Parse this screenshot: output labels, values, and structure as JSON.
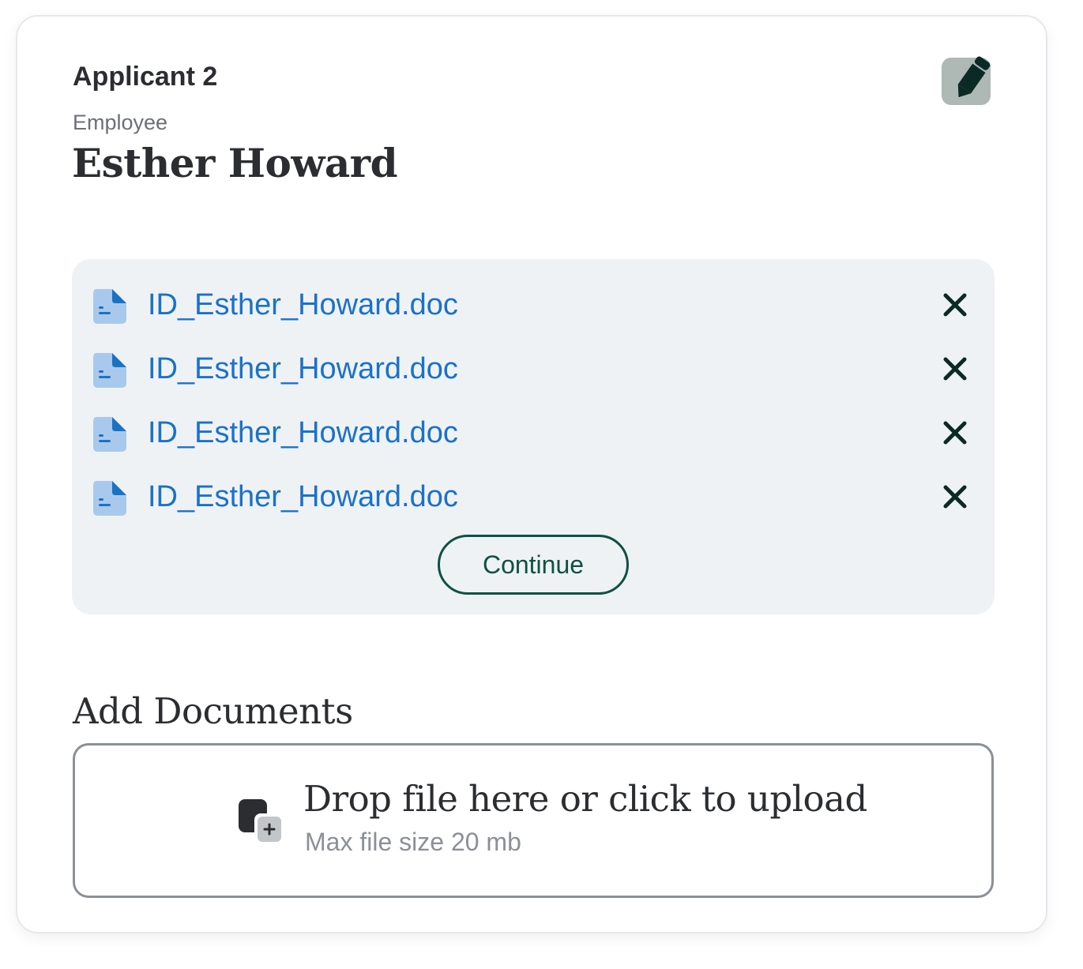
{
  "applicant": {
    "label": "Applicant 2",
    "role": "Employee",
    "name": "Esther Howard",
    "edit_icon": "pencil-icon"
  },
  "files": {
    "items": [
      {
        "name": "ID_Esther_Howard.doc"
      },
      {
        "name": "ID_Esther_Howard.doc"
      },
      {
        "name": "ID_Esther_Howard.doc"
      },
      {
        "name": "ID_Esther_Howard.doc"
      }
    ],
    "file_icon": "document-icon",
    "remove_icon": "close-icon",
    "continue_label": "Continue"
  },
  "upload": {
    "section_title": "Add Documents",
    "drop_text": "Drop file here or click to upload",
    "hint": "Max file size 20 mb",
    "icon": "upload-file-icon"
  },
  "colors": {
    "accent_green": "#0e5145",
    "link_blue": "#1a72c7",
    "panel_bg": "#eff2f5",
    "edit_button_bg": "#aeb8b5"
  }
}
